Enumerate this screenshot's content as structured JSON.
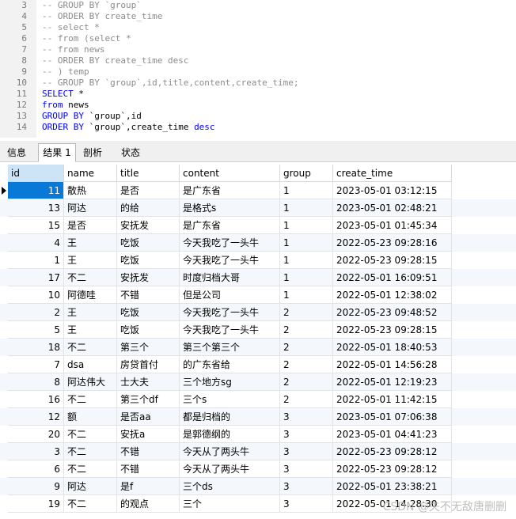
{
  "editor": {
    "lines": [
      {
        "n": "3",
        "parts": [
          {
            "t": "-- GROUP BY `group`",
            "c": "comment"
          }
        ]
      },
      {
        "n": "4",
        "parts": [
          {
            "t": "-- ORDER BY create_time",
            "c": "comment"
          }
        ]
      },
      {
        "n": "5",
        "parts": [
          {
            "t": "-- select *",
            "c": "comment"
          }
        ]
      },
      {
        "n": "6",
        "parts": [
          {
            "t": "-- from (select *",
            "c": "comment"
          }
        ]
      },
      {
        "n": "7",
        "parts": [
          {
            "t": "-- from news",
            "c": "comment"
          }
        ]
      },
      {
        "n": "8",
        "parts": [
          {
            "t": "-- ORDER BY create_time desc",
            "c": "comment"
          }
        ]
      },
      {
        "n": "9",
        "parts": [
          {
            "t": "-- ) temp",
            "c": "comment"
          }
        ]
      },
      {
        "n": "10",
        "parts": [
          {
            "t": "-- GROUP BY `group`,id,title,content,create_time;",
            "c": "comment"
          }
        ]
      },
      {
        "n": "11",
        "parts": [
          {
            "t": "SELECT",
            "c": "kw"
          },
          {
            "t": " *",
            "c": "plain"
          }
        ]
      },
      {
        "n": "12",
        "parts": [
          {
            "t": "from",
            "c": "kw"
          },
          {
            "t": " news",
            "c": "plain"
          }
        ]
      },
      {
        "n": "13",
        "parts": [
          {
            "t": "GROUP BY",
            "c": "kw"
          },
          {
            "t": " `group`,id",
            "c": "plain"
          }
        ]
      },
      {
        "n": "14",
        "parts": [
          {
            "t": "ORDER BY",
            "c": "kw"
          },
          {
            "t": " `group`,create_time ",
            "c": "plain"
          },
          {
            "t": "desc",
            "c": "kw"
          }
        ]
      }
    ]
  },
  "tabs": [
    {
      "label": "信息",
      "active": false
    },
    {
      "label": "结果 1",
      "active": true
    },
    {
      "label": "剖析",
      "active": false
    },
    {
      "label": "状态",
      "active": false
    }
  ],
  "grid": {
    "columns": [
      "id",
      "name",
      "title",
      "content",
      "group",
      "create_time"
    ],
    "rows": [
      [
        "11",
        "散热",
        "是否",
        "是广东省",
        "1",
        "2023-05-01 03:12:15"
      ],
      [
        "13",
        "阿达",
        "的给",
        "是格式s",
        "1",
        "2023-05-01 02:48:21"
      ],
      [
        "15",
        "是否",
        " 安抚发",
        "是广东省",
        "1",
        "2023-05-01 01:45:34"
      ],
      [
        "4",
        "王",
        "吃饭",
        "今天我吃了一头牛",
        "1",
        "2022-05-23 09:28:16"
      ],
      [
        "1",
        "王",
        "吃饭",
        "今天我吃了一头牛",
        "1",
        "2022-05-23 09:28:15"
      ],
      [
        "17",
        "不二",
        " 安抚发",
        "时度归档大哥",
        "1",
        "2022-05-01 16:09:51"
      ],
      [
        "10",
        "阿德哇",
        "不错",
        "但是公司",
        "1",
        "2022-05-01 12:38:02"
      ],
      [
        "2",
        "王",
        "吃饭",
        "今天我吃了一头牛",
        "2",
        "2022-05-23 09:48:52"
      ],
      [
        "5",
        "王",
        "吃饭",
        "今天我吃了一头牛",
        "2",
        "2022-05-23 09:28:15"
      ],
      [
        "18",
        "不二",
        "第三个",
        "第三个第三个",
        "2",
        "2022-05-01 18:40:53"
      ],
      [
        "7",
        "dsa",
        "房贷首付",
        "的广东省给",
        "2",
        "2022-05-01 14:56:28"
      ],
      [
        "8",
        "阿达伟大",
        " 士大夫",
        "三个地方sg",
        "2",
        "2022-05-01 12:19:23"
      ],
      [
        "16",
        "不二",
        "第三个df",
        " 三个s",
        "2",
        "2022-05-01 11:42:15"
      ],
      [
        "12",
        "额",
        "是否aa",
        "都是归档的",
        "3",
        "2023-05-01 07:06:38"
      ],
      [
        "20",
        "不二",
        " 安抚a",
        "是郭德纲的",
        "3",
        "2023-05-01 04:41:23"
      ],
      [
        "3",
        "不二",
        "不错",
        "今天从了两头牛",
        "3",
        "2022-05-23 09:28:12"
      ],
      [
        "6",
        "不二",
        "不错",
        "今天从了两头牛",
        "3",
        "2022-05-23 09:28:12"
      ],
      [
        "9",
        "阿达",
        "是f",
        " 三个ds",
        "3",
        "2022-05-01 23:38:21"
      ],
      [
        "19",
        "不二",
        "的观点",
        " 三个",
        "3",
        "2022-05-01 14:28:30"
      ]
    ]
  },
  "watermark": "CSDN @失不无敌唐删删"
}
